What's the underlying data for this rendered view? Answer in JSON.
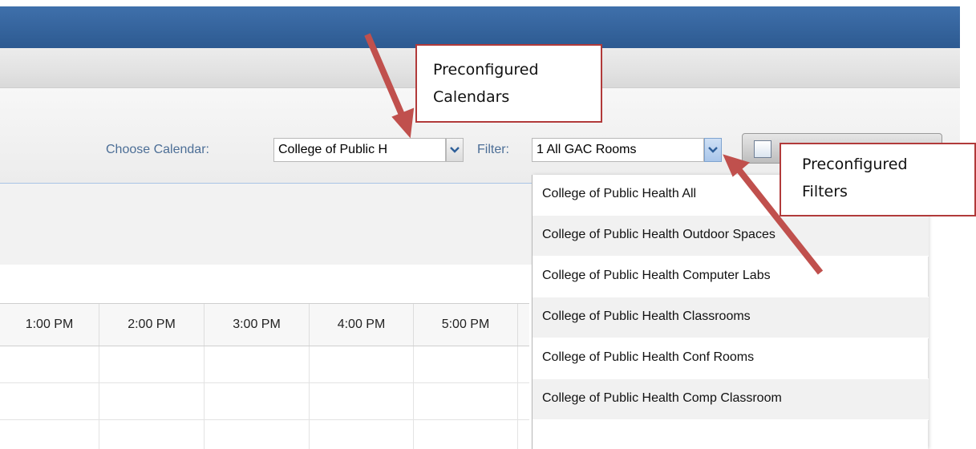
{
  "toolbar": {
    "calendar_label": "Choose Calendar:",
    "calendar_value": "College of Public H",
    "filter_label": "Filter:",
    "filter_value": "1 All GAC Rooms"
  },
  "time_headers": [
    "1:00 PM",
    "2:00 PM",
    "3:00 PM",
    "4:00 PM",
    "5:00 PM"
  ],
  "filter_options": [
    "College of Public Health All",
    "College of Public Health Outdoor Spaces",
    "College of Public Health Computer Labs",
    "College of Public Health Classrooms",
    "College of Public Health Conf Rooms",
    "College of Public Health Comp Classroom"
  ],
  "annotations": {
    "calendars_line1": "Preconfigured",
    "calendars_line2": "Calendars",
    "filters_line1": "Preconfigured",
    "filters_line2": "Filters"
  },
  "colors": {
    "header_blue": "#2d5a91",
    "label_blue": "#4c6e96",
    "annotation_red": "#c0504d"
  },
  "icons": [
    "chevron-down-icon",
    "calendar-icon",
    "arrow-icon"
  ]
}
